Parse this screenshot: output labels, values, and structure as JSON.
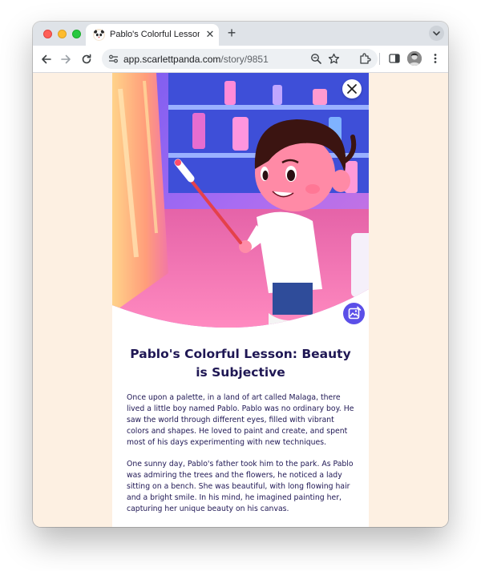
{
  "browser": {
    "tab": {
      "title": "Pablo's Colorful Lesson: Beau",
      "close_glyph": "✕"
    },
    "new_tab_glyph": "+",
    "url_host": "app.scarlettpanda.com",
    "url_path": "/story/9851"
  },
  "story": {
    "title": "Pablo's Colorful Lesson: Beauty is Subjective",
    "paragraphs": [
      "Once upon a palette, in a land of art called Malaga, there lived a little boy named Pablo. Pablo was no ordinary boy. He saw the world through different eyes, filled with vibrant colors and shapes. He loved to paint and create, and spent most of his days experimenting with new techniques.",
      "One sunny day, Pablo's father took him to the park. As Pablo was admiring the trees and the flowers, he noticed a lady sitting on a bench. She was beautiful, with long flowing hair and a bright smile. In his mind, he imagined painting her, capturing her unique beauty on his canvas."
    ]
  },
  "colors": {
    "page_background": "#fdf0e2",
    "title_color": "#1f1754",
    "accent_button": "#5b4fe8"
  },
  "icons": {
    "close": "close-icon",
    "image": "image-icon",
    "zoom": "zoom-icon",
    "star": "star-icon",
    "extensions": "puzzle-icon",
    "sidepanel": "sidepanel-icon",
    "menu": "kebab-menu-icon"
  }
}
